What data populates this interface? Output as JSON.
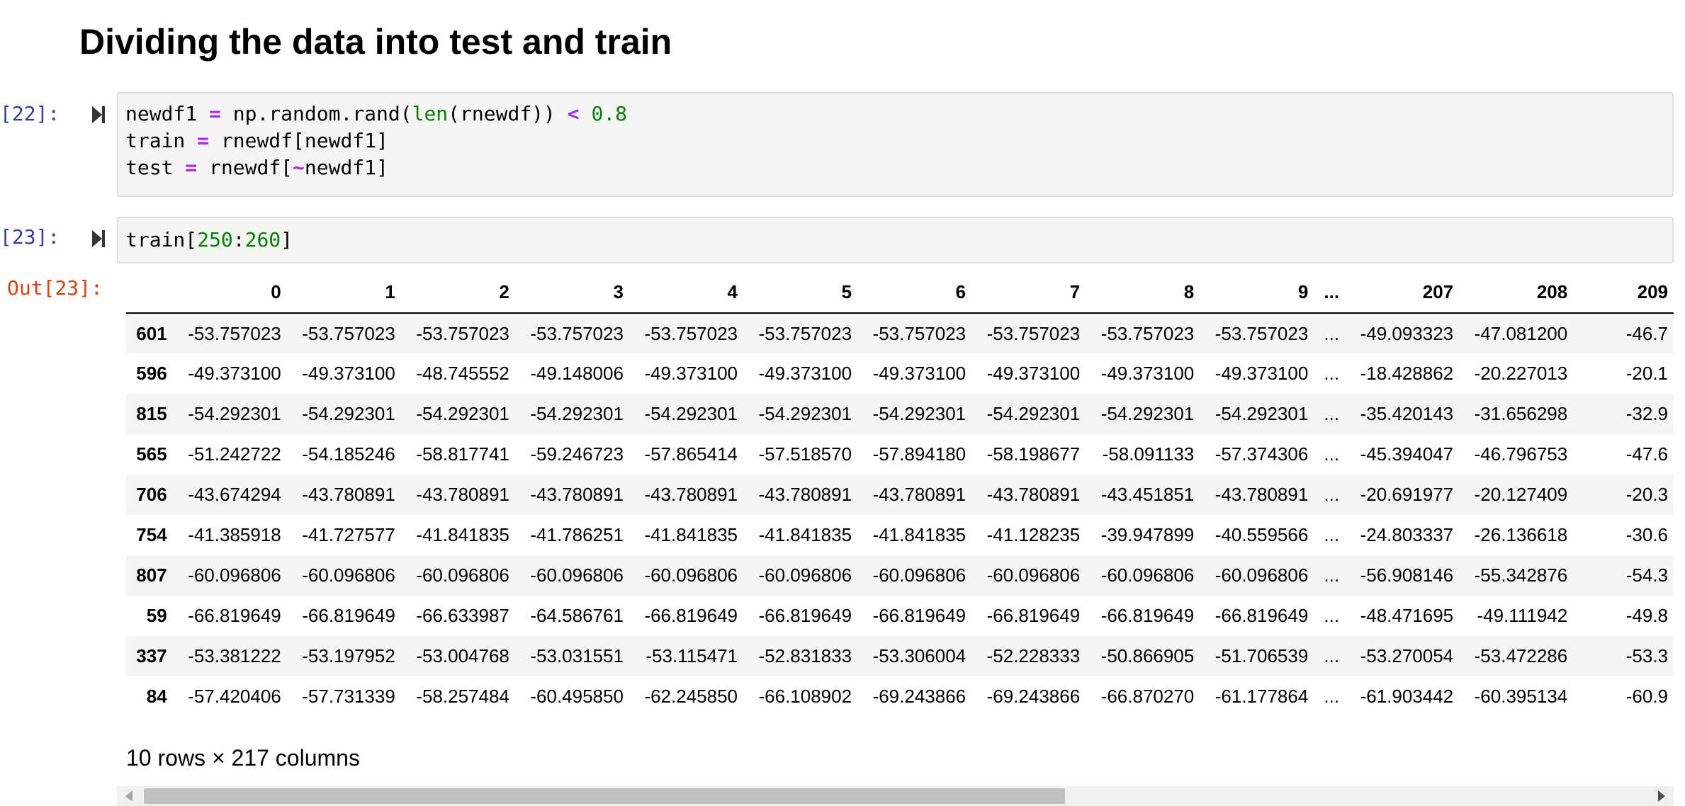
{
  "heading": "Dividing the data into test and train",
  "cell22": {
    "prompt": "[22]:",
    "lines": [
      [
        {
          "t": "newdf1 ",
          "c": "plain"
        },
        {
          "t": "=",
          "c": "op"
        },
        {
          "t": " np.random.rand(",
          "c": "plain"
        },
        {
          "t": "len",
          "c": "builtin"
        },
        {
          "t": "(rnewdf)) ",
          "c": "plain"
        },
        {
          "t": "<",
          "c": "op"
        },
        {
          "t": " ",
          "c": "plain"
        },
        {
          "t": "0.8",
          "c": "num"
        }
      ],
      [
        {
          "t": "train ",
          "c": "plain"
        },
        {
          "t": "=",
          "c": "op"
        },
        {
          "t": " rnewdf[newdf1]",
          "c": "plain"
        }
      ],
      [
        {
          "t": "test ",
          "c": "plain"
        },
        {
          "t": "=",
          "c": "op"
        },
        {
          "t": " rnewdf[",
          "c": "plain"
        },
        {
          "t": "~",
          "c": "op"
        },
        {
          "t": "newdf1]",
          "c": "plain"
        }
      ]
    ]
  },
  "cell23": {
    "prompt": "[23]:",
    "out_prompt": "Out[23]:",
    "lines": [
      [
        {
          "t": "train[",
          "c": "plain"
        },
        {
          "t": "250",
          "c": "num"
        },
        {
          "t": ":",
          "c": "plain"
        },
        {
          "t": "260",
          "c": "num"
        },
        {
          "t": "]",
          "c": "plain"
        }
      ]
    ]
  },
  "dataframe": {
    "columns": [
      "0",
      "1",
      "2",
      "3",
      "4",
      "5",
      "6",
      "7",
      "8",
      "9",
      "...",
      "207",
      "208",
      "209"
    ],
    "rows": [
      {
        "index": "601",
        "values": [
          "-53.757023",
          "-53.757023",
          "-53.757023",
          "-53.757023",
          "-53.757023",
          "-53.757023",
          "-53.757023",
          "-53.757023",
          "-53.757023",
          "-53.757023",
          "...",
          "-49.093323",
          "-47.081200",
          "-46.7"
        ]
      },
      {
        "index": "596",
        "values": [
          "-49.373100",
          "-49.373100",
          "-48.745552",
          "-49.148006",
          "-49.373100",
          "-49.373100",
          "-49.373100",
          "-49.373100",
          "-49.373100",
          "-49.373100",
          "...",
          "-18.428862",
          "-20.227013",
          "-20.1"
        ]
      },
      {
        "index": "815",
        "values": [
          "-54.292301",
          "-54.292301",
          "-54.292301",
          "-54.292301",
          "-54.292301",
          "-54.292301",
          "-54.292301",
          "-54.292301",
          "-54.292301",
          "-54.292301",
          "...",
          "-35.420143",
          "-31.656298",
          "-32.9"
        ]
      },
      {
        "index": "565",
        "values": [
          "-51.242722",
          "-54.185246",
          "-58.817741",
          "-59.246723",
          "-57.865414",
          "-57.518570",
          "-57.894180",
          "-58.198677",
          "-58.091133",
          "-57.374306",
          "...",
          "-45.394047",
          "-46.796753",
          "-47.6"
        ]
      },
      {
        "index": "706",
        "values": [
          "-43.674294",
          "-43.780891",
          "-43.780891",
          "-43.780891",
          "-43.780891",
          "-43.780891",
          "-43.780891",
          "-43.780891",
          "-43.451851",
          "-43.780891",
          "...",
          "-20.691977",
          "-20.127409",
          "-20.3"
        ]
      },
      {
        "index": "754",
        "values": [
          "-41.385918",
          "-41.727577",
          "-41.841835",
          "-41.786251",
          "-41.841835",
          "-41.841835",
          "-41.841835",
          "-41.128235",
          "-39.947899",
          "-40.559566",
          "...",
          "-24.803337",
          "-26.136618",
          "-30.6"
        ]
      },
      {
        "index": "807",
        "values": [
          "-60.096806",
          "-60.096806",
          "-60.096806",
          "-60.096806",
          "-60.096806",
          "-60.096806",
          "-60.096806",
          "-60.096806",
          "-60.096806",
          "-60.096806",
          "...",
          "-56.908146",
          "-55.342876",
          "-54.3"
        ]
      },
      {
        "index": "59",
        "values": [
          "-66.819649",
          "-66.819649",
          "-66.633987",
          "-64.586761",
          "-66.819649",
          "-66.819649",
          "-66.819649",
          "-66.819649",
          "-66.819649",
          "-66.819649",
          "...",
          "-48.471695",
          "-49.111942",
          "-49.8"
        ]
      },
      {
        "index": "337",
        "values": [
          "-53.381222",
          "-53.197952",
          "-53.004768",
          "-53.031551",
          "-53.115471",
          "-52.831833",
          "-53.306004",
          "-52.228333",
          "-50.866905",
          "-51.706539",
          "...",
          "-53.270054",
          "-53.472286",
          "-53.3"
        ]
      },
      {
        "index": "84",
        "values": [
          "-57.420406",
          "-57.731339",
          "-58.257484",
          "-60.495850",
          "-62.245850",
          "-66.108902",
          "-69.243866",
          "-69.243866",
          "-66.870270",
          "-61.177864",
          "...",
          "-61.903442",
          "-60.395134",
          "-60.9"
        ]
      }
    ],
    "shape": "10 rows × 217 columns"
  },
  "icons": {
    "run": "run-cell-icon",
    "scroll_left": "chevron-left-icon",
    "scroll_right": "chevron-right-icon"
  },
  "colors": {
    "prompt_in": "#303f9f",
    "prompt_out": "#d84315",
    "keyword_op": "#aa22ff",
    "number": "#008000",
    "code_bg": "#f5f5f5"
  }
}
